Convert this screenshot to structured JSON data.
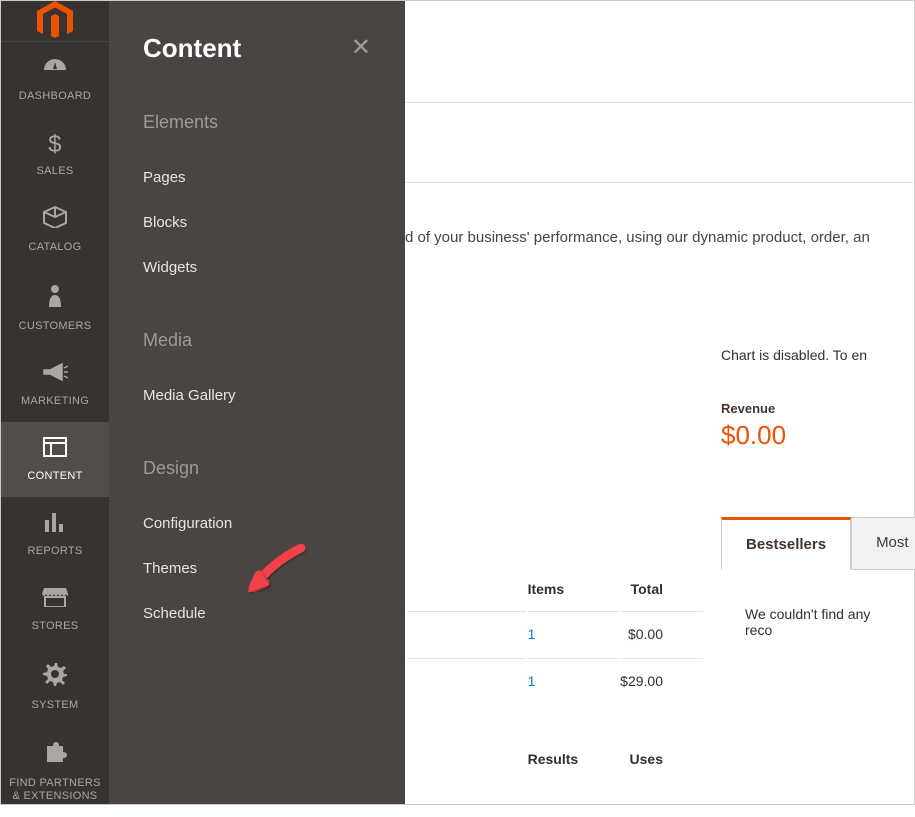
{
  "sidebar": {
    "items": [
      {
        "label": "DASHBOARD"
      },
      {
        "label": "SALES"
      },
      {
        "label": "CATALOG"
      },
      {
        "label": "CUSTOMERS"
      },
      {
        "label": "MARKETING"
      },
      {
        "label": "CONTENT"
      },
      {
        "label": "REPORTS"
      },
      {
        "label": "STORES"
      },
      {
        "label": "SYSTEM"
      },
      {
        "label": "FIND PARTNERS & EXTENSIONS"
      }
    ]
  },
  "flyout": {
    "title": "Content",
    "sections": {
      "elements": {
        "title": "Elements",
        "links": [
          "Pages",
          "Blocks",
          "Widgets"
        ]
      },
      "media": {
        "title": "Media",
        "links": [
          "Media Gallery"
        ]
      },
      "design": {
        "title": "Design",
        "links": [
          "Configuration",
          "Themes",
          "Schedule"
        ]
      }
    }
  },
  "main": {
    "perf_msg": "d of your business' performance, using our dynamic product, order, an",
    "chart_msg": "Chart is disabled. To en",
    "revenue_label": "Revenue",
    "revenue_value": "$0.00",
    "tabs": {
      "bestsellers": "Bestsellers",
      "most": "Most"
    },
    "tab_empty": "We couldn't find any reco",
    "table": {
      "cols": {
        "items": "Items",
        "total": "Total",
        "results": "Results",
        "uses": "Uses"
      },
      "rows": [
        {
          "items": "1",
          "total": "$0.00"
        },
        {
          "items": "1",
          "total": "$29.00"
        }
      ]
    }
  }
}
